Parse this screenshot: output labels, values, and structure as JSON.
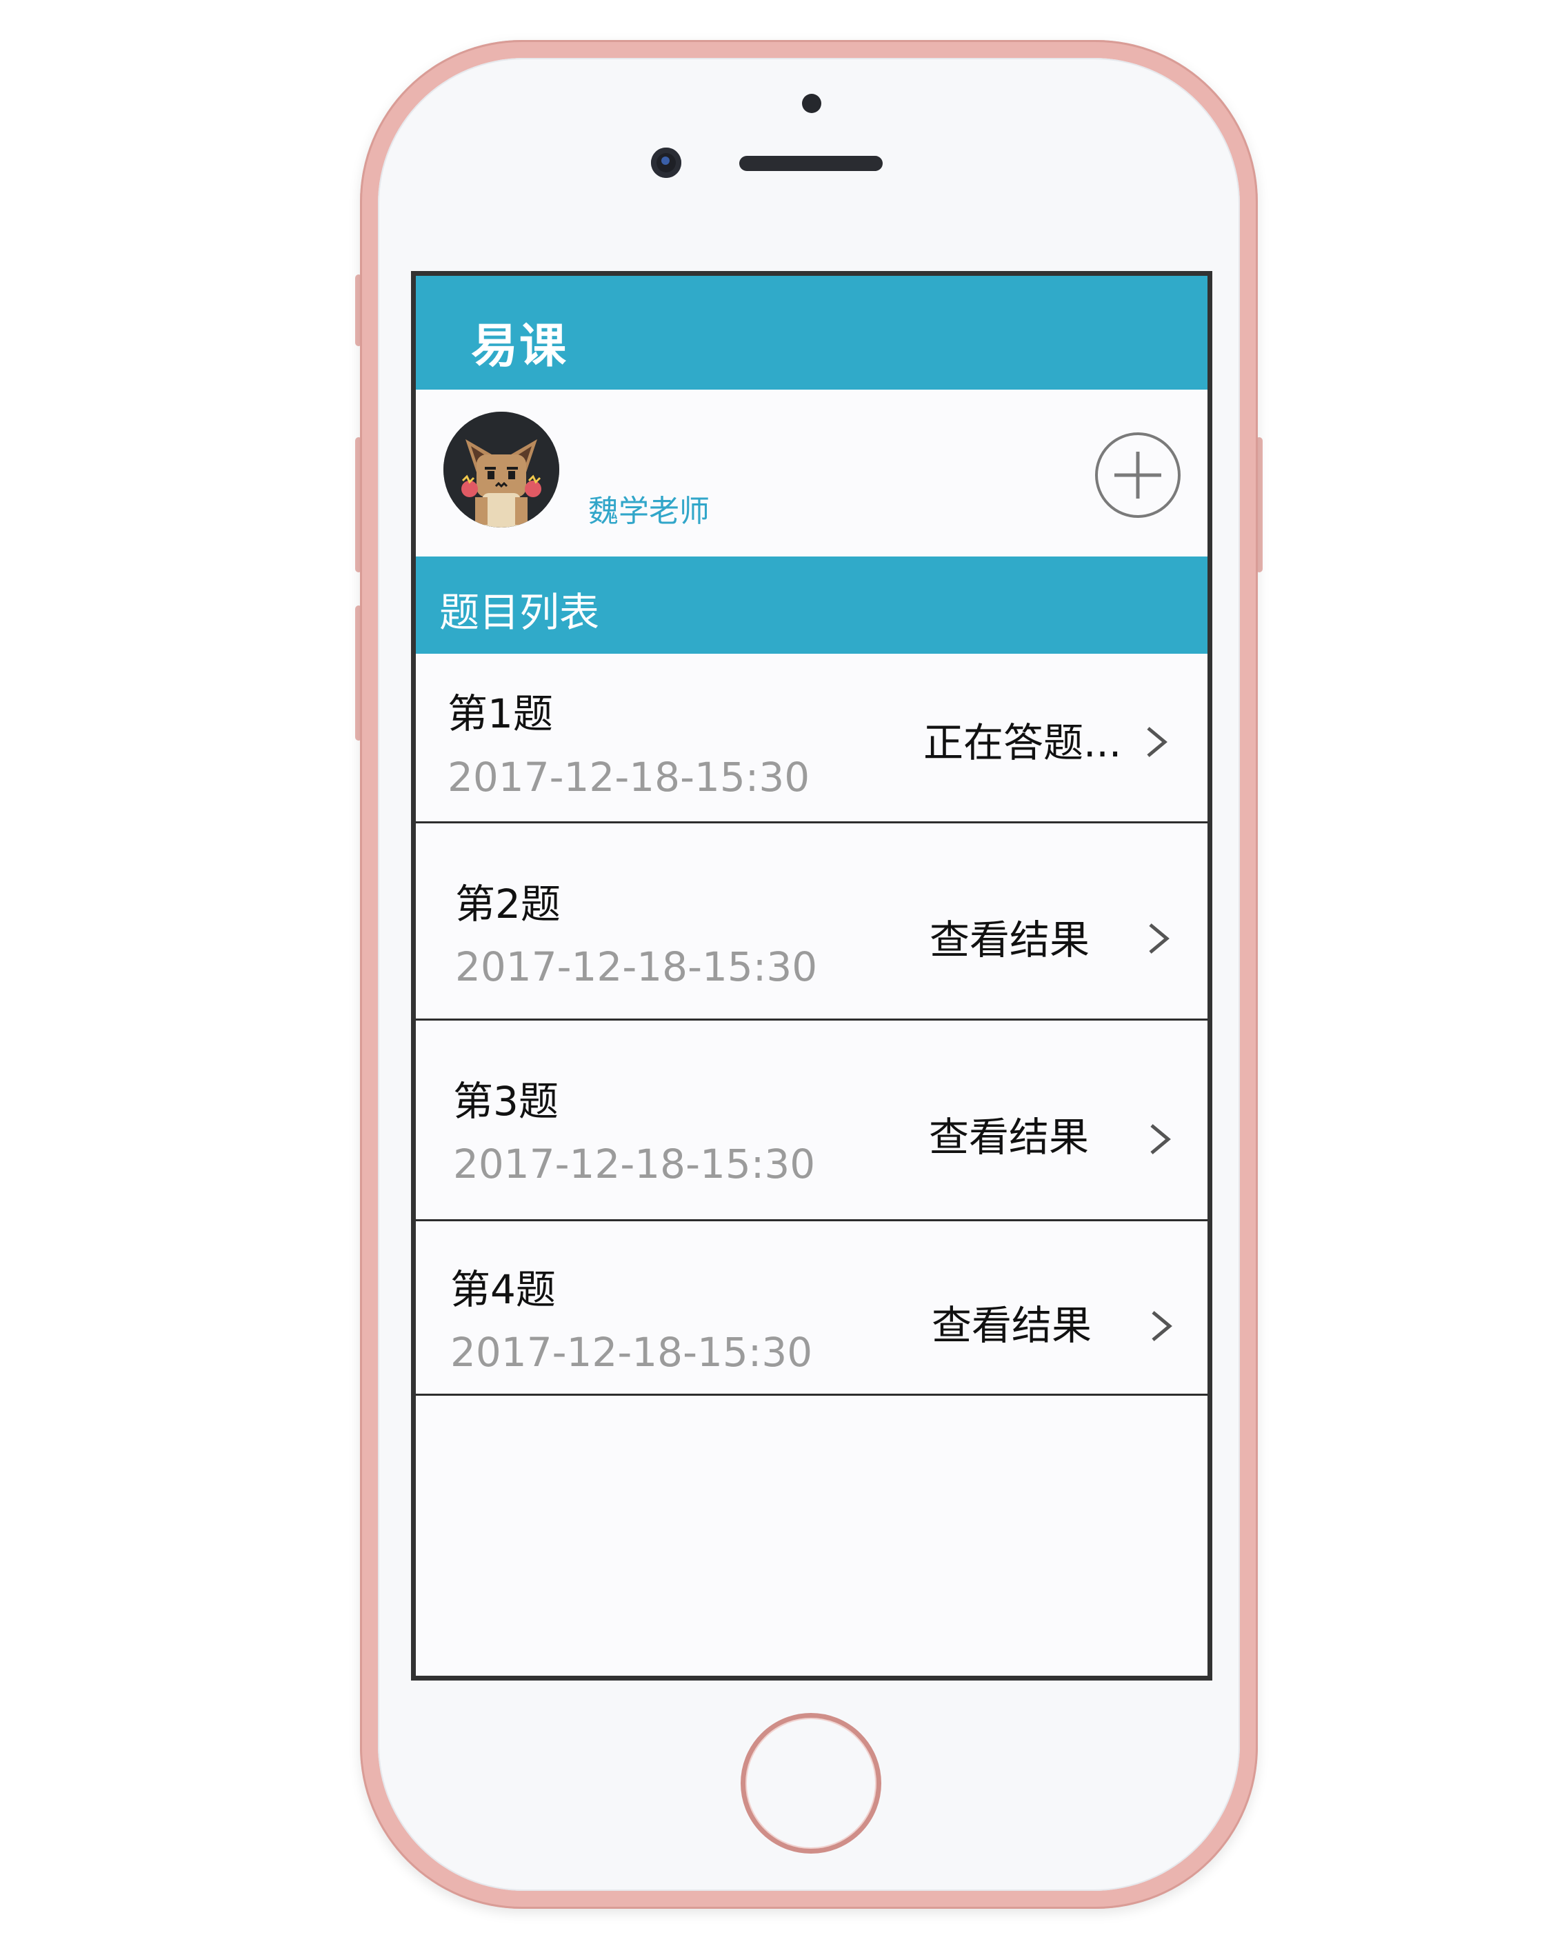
{
  "app": {
    "title": "易课"
  },
  "profile": {
    "teacher_name": "魏学老师",
    "avatar_icon": "pokemon-eevee-avatar",
    "add_icon": "plus-circle-icon"
  },
  "section": {
    "title": "题目列表"
  },
  "questions": [
    {
      "title": "第1题",
      "date": "2017-12-18-15:30",
      "status": "正在答题..."
    },
    {
      "title": "第2题",
      "date": "2017-12-18-15:30",
      "status": "查看结果"
    },
    {
      "title": "第3题",
      "date": "2017-12-18-15:30",
      "status": "查看结果"
    },
    {
      "title": "第4题",
      "date": "2017-12-18-15:30",
      "status": "查看结果"
    }
  ],
  "colors": {
    "accent": "#30aac9",
    "phone_frame": "#eab4af",
    "date_text": "#9b9b9b"
  }
}
